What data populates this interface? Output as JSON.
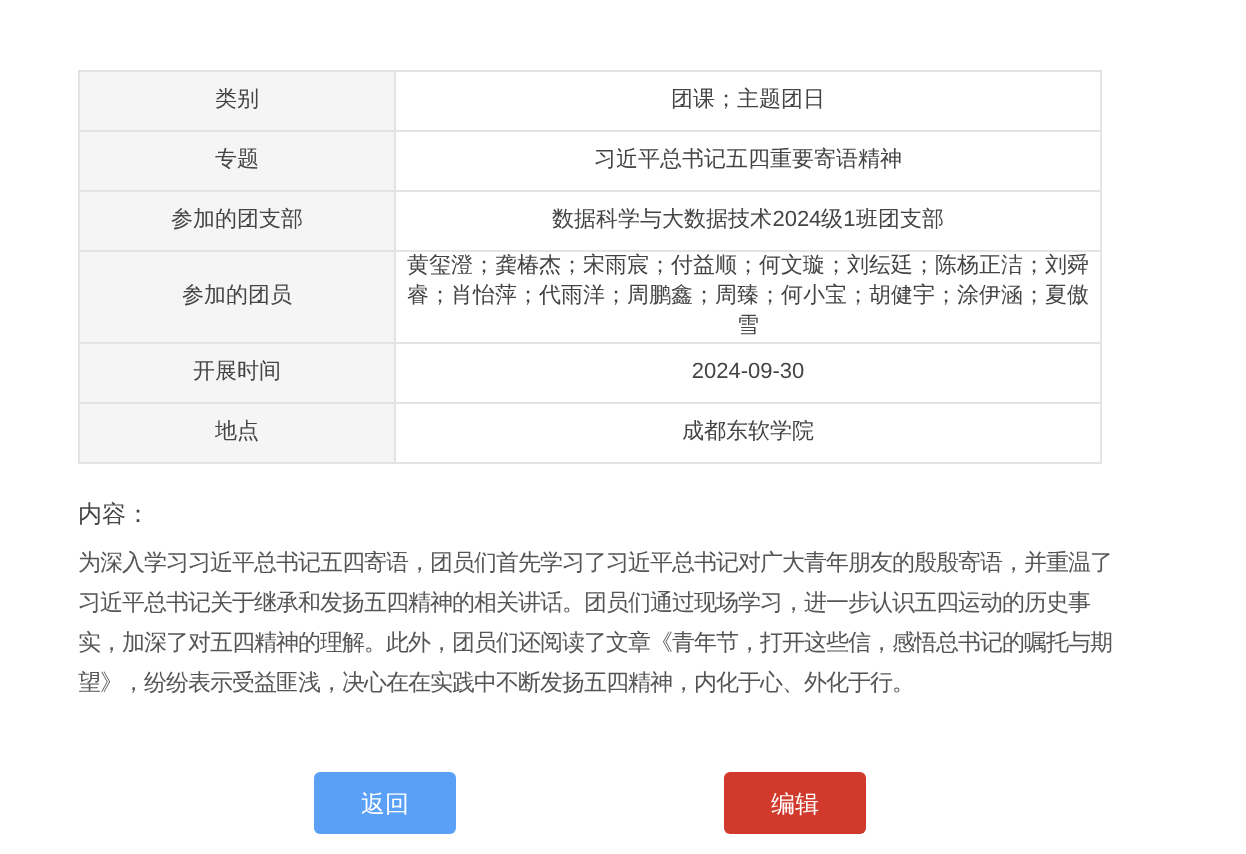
{
  "details": [
    {
      "label": "类别",
      "value": "团课；主题团日"
    },
    {
      "label": "专题",
      "value": "习近平总书记五四重要寄语精神"
    },
    {
      "label": "参加的团支部",
      "value": "数据科学与大数据技术2024级1班团支部"
    },
    {
      "label": "参加的团员",
      "value": "黄玺澄；龚椿杰；宋雨宸；付益顺；何文璇；刘纭廷；陈杨正洁；刘舜睿；肖怡萍；代雨洋；周鹏鑫；周臻；何小宝；胡健宇；涂伊涵；夏傲雪"
    },
    {
      "label": "开展时间",
      "value": "2024-09-30"
    },
    {
      "label": "地点",
      "value": "成都东软学院"
    }
  ],
  "content_label": "内容：",
  "content": "为深入学习习近平总书记五四寄语，团员们首先学习了习近平总书记对广大青年朋友的殷殷寄语，并重温了习近平总书记关于继承和发扬五四精神的相关讲话。团员们通过现场学习，进一步认识五四运动的历史事实，加深了对五四精神的理解。此外，团员们还阅读了文章《青年节，打开这些信，感悟总书记的嘱托与期望》，纷纷表示受益匪浅，决心在在实践中不断发扬五四精神，内化于心、外化于行。",
  "buttons": [
    {
      "label": "返回",
      "kind": "back"
    },
    {
      "label": "编辑",
      "kind": "edit"
    }
  ]
}
